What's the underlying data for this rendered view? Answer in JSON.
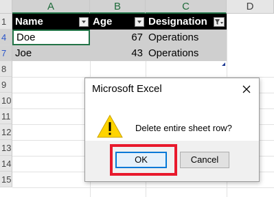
{
  "spreadsheet": {
    "columns": [
      "A",
      "B",
      "C",
      "D"
    ],
    "rows": [
      "1",
      "4",
      "7",
      "8",
      "9",
      "10",
      "11",
      "12",
      "13",
      "14",
      "15"
    ],
    "header": {
      "name": "Name",
      "age": "Age",
      "designation": "Designation"
    },
    "data": [
      {
        "name": "Doe",
        "age": "67",
        "designation": "Operations"
      },
      {
        "name": "Joe",
        "age": "43",
        "designation": "Operations"
      }
    ]
  },
  "dialog": {
    "title": "Microsoft Excel",
    "message": "Delete entire sheet row?",
    "ok_label": "OK",
    "cancel_label": "Cancel",
    "icon": "warning-icon"
  },
  "colors": {
    "header_bg": "#000000",
    "selected_row_bg": "#cfcfcf",
    "accent": "#0078d7",
    "highlight": "#e8192c"
  }
}
